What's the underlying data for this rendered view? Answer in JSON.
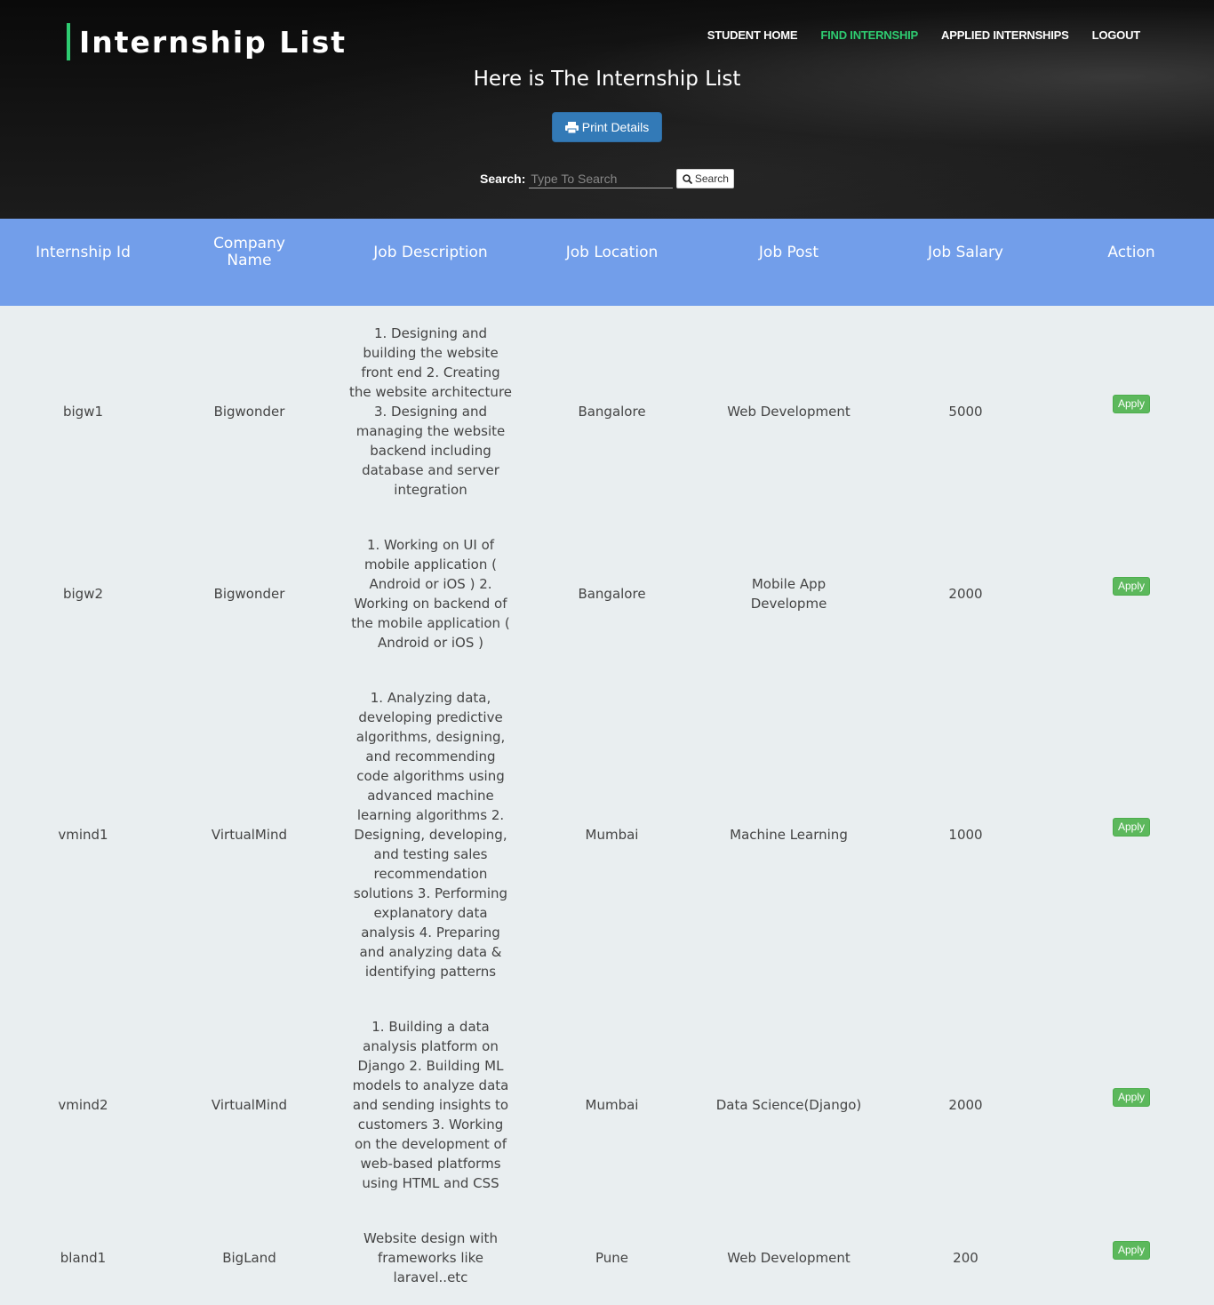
{
  "header": {
    "brand": "Internship List",
    "nav": [
      {
        "label": "STUDENT HOME",
        "active": false
      },
      {
        "label": "FIND INTERNSHIP",
        "active": true
      },
      {
        "label": "APPLIED INTERNSHIPS",
        "active": false
      },
      {
        "label": "LOGOUT",
        "active": false
      }
    ],
    "title": "Here is The Internship List",
    "print_label": "Print Details",
    "search_label": "Search:",
    "search_placeholder": "Type To Search",
    "search_button": "Search"
  },
  "colors": {
    "accent": "#2ecc71",
    "table_header": "#729eea",
    "print_button": "#337ab7",
    "apply_button": "#5cb85c"
  },
  "icons": {
    "print": "print-icon",
    "search": "search-icon"
  },
  "table": {
    "columns": [
      "Internship Id",
      "Company Name",
      "Job Description",
      "Job Location",
      "Job Post",
      "Job Salary",
      "Action"
    ],
    "rows": [
      {
        "id": "bigw1",
        "company": "Bigwonder",
        "description": "1. Designing and building the website front end 2. Creating the website architecture 3. Designing and managing the website backend including database and server integration",
        "location": "Bangalore",
        "post": "Web Development",
        "salary": "5000",
        "action": "Apply"
      },
      {
        "id": "bigw2",
        "company": "Bigwonder",
        "description": "1. Working on UI of mobile application ( Android or iOS ) 2. Working on backend of the mobile application ( Android or iOS )",
        "location": "Bangalore",
        "post": "Mobile App Developme",
        "salary": "2000",
        "action": "Apply"
      },
      {
        "id": "vmind1",
        "company": "VirtualMind",
        "description": "1. Analyzing data, developing predictive algorithms, designing, and recommending code algorithms using advanced machine learning algorithms 2. Designing, developing, and testing sales recommendation solutions 3. Performing explanatory data analysis 4. Preparing and analyzing data & identifying patterns",
        "location": "Mumbai",
        "post": "Machine Learning",
        "salary": "1000",
        "action": "Apply"
      },
      {
        "id": "vmind2",
        "company": "VirtualMind",
        "description": "1. Building a data analysis platform on Django 2. Building ML models to analyze data and sending insights to customers 3. Working on the development of web-based platforms using HTML and CSS",
        "location": "Mumbai",
        "post": "Data Science(Django)",
        "salary": "2000",
        "action": "Apply"
      },
      {
        "id": "bland1",
        "company": "BigLand",
        "description": "Website design with frameworks like laravel..etc",
        "location": "Pune",
        "post": "Web Development",
        "salary": "200",
        "action": "Apply"
      }
    ]
  }
}
